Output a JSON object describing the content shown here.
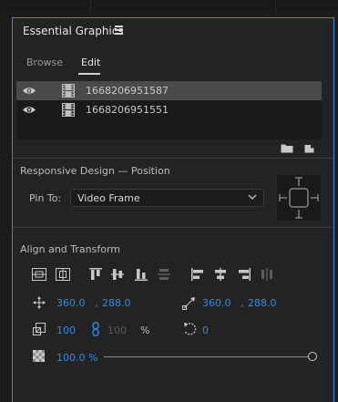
{
  "panel": {
    "title": "Essential Graphics",
    "menu_icon": "hamburger-menu-icon"
  },
  "tabs": [
    {
      "label": "Browse",
      "active": false
    },
    {
      "label": "Edit",
      "active": true
    }
  ],
  "layers": [
    {
      "name": "1668206951587",
      "visible": true,
      "selected": true
    },
    {
      "name": "1668206951551",
      "visible": true,
      "selected": false
    }
  ],
  "layer_tools": [
    "new-folder-icon",
    "new-layer-icon"
  ],
  "responsive_design": {
    "title": "Responsive Design — Position",
    "pin_label": "Pin To:",
    "pin_value": "Video Frame"
  },
  "align_transform": {
    "title": "Align and Transform",
    "position": {
      "x": "360.0",
      "y": "288.0"
    },
    "anchor": {
      "x": "360.0",
      "y": "288.0"
    },
    "scale": {
      "value": "100",
      "linked_value": "100",
      "unit": "%"
    },
    "rotation": "0",
    "opacity": "100.0 %"
  },
  "colors": {
    "accent": "#2d8ceb",
    "panel_bg": "#232323",
    "selected_row": "#4a4a4a"
  }
}
